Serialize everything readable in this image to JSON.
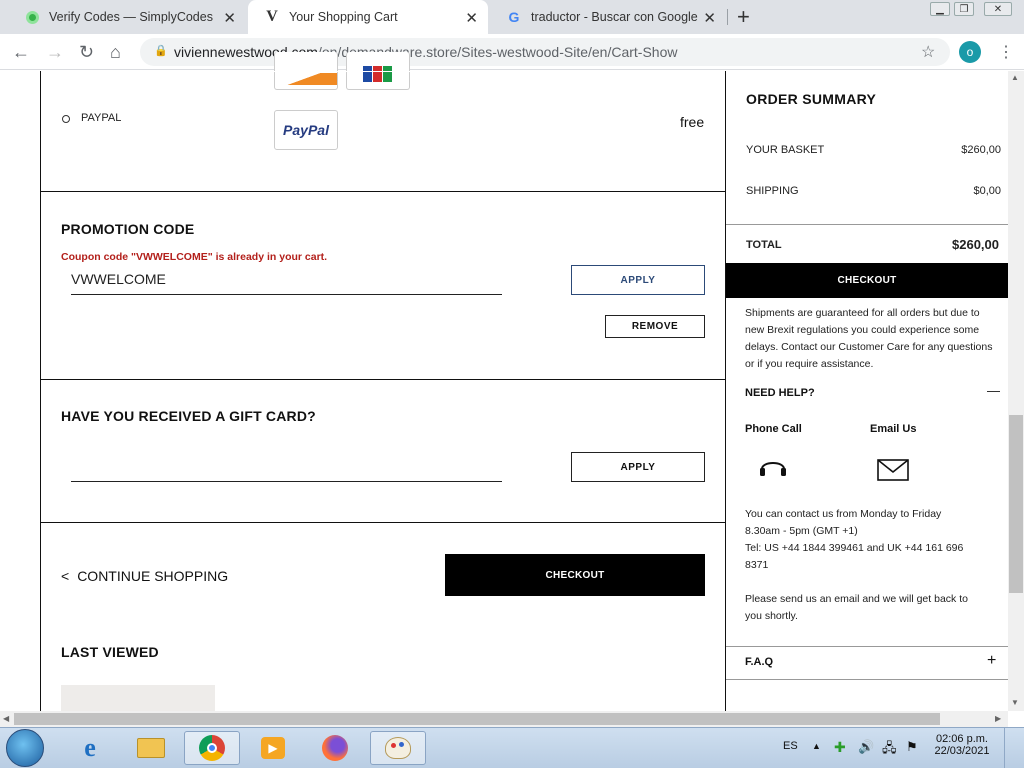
{
  "browser": {
    "tabs": [
      {
        "title": "Verify Codes — SimplyCodes",
        "icon": "simplycodes-icon"
      },
      {
        "title": "Your Shopping Cart",
        "icon": "vivienne-westwood-icon"
      },
      {
        "title": "traductor - Buscar con Google",
        "icon": "google-icon"
      }
    ],
    "url_domain": "viviennewestwood.com",
    "url_path": "/on/demandware.store/Sites-westwood-Site/en/Cart-Show",
    "profile_initial": "o"
  },
  "payment": {
    "paypal_label": "PAYPAL",
    "paypal_logo_text": "PayPal",
    "paypal_price": "free"
  },
  "promo": {
    "heading": "PROMOTION CODE",
    "message": "Coupon code \"VWWELCOME\" is already in your cart.",
    "code_value": "VWWELCOME",
    "apply_label": "APPLY",
    "remove_label": "REMOVE"
  },
  "gift": {
    "heading": "HAVE YOU RECEIVED A GIFT CARD?",
    "apply_label": "APPLY"
  },
  "cart_actions": {
    "continue_arrow": "<",
    "continue_label": "CONTINUE SHOPPING",
    "checkout_label": "CHECKOUT"
  },
  "last_viewed": {
    "heading": "LAST VIEWED"
  },
  "summary": {
    "title": "ORDER SUMMARY",
    "basket_label": "YOUR BASKET",
    "basket_value": "$260,00",
    "shipping_label": "SHIPPING",
    "shipping_value": "$0,00",
    "total_label": "TOTAL",
    "total_value": "$260,00",
    "checkout_label": "CHECKOUT",
    "brexit_note": "Shipments are guaranteed for all orders but due to new Brexit regulations you could experience some delays. Contact our Customer Care for any questions or if you require assistance."
  },
  "help": {
    "heading": "NEED HELP?",
    "toggle_symbol": "—",
    "phone_label": "Phone Call",
    "email_label": "Email Us",
    "hours_1": "You can contact us from Monday to Friday",
    "hours_2": "8.30am - 5pm (GMT +1)",
    "tel_1": "Tel: US +44 1844 399461 and UK +44 161 696",
    "tel_2": "8371",
    "email_note_1": "Please send us an email and we will get back to",
    "email_note_2": "you shortly.",
    "faq_label": "F.A.Q",
    "faq_toggle": "+"
  },
  "taskbar": {
    "language": "ES",
    "time": "02:06 p.m.",
    "date": "22/03/2021"
  },
  "colors": {
    "error": "#b3201b",
    "accent_button_border": "#2c4a78",
    "checkout_bg": "#000000"
  }
}
